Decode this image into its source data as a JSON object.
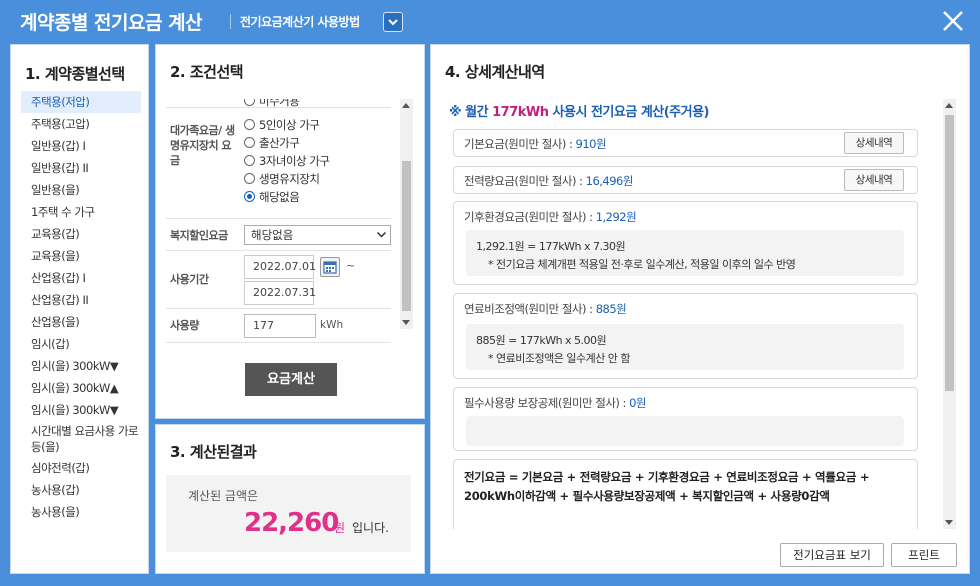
{
  "header": {
    "title": "계약종별 전기요금 계산",
    "help_link": "전기요금계산기 사용방법"
  },
  "panel1": {
    "title": "1. 계약종별선택",
    "items": [
      "주택용(저압)",
      "주택용(고압)",
      "일반용(갑) I",
      "일반용(갑) II",
      "일반용(을)",
      "1주택 수 가구",
      "교육용(갑)",
      "교육용(을)",
      "산업용(갑) I",
      "산업용(갑) II",
      "산업용(을)",
      "임시(갑)",
      "임시(을) 300kW▼",
      "임시(을) 300kW▲",
      "임시(을) 300kW▼",
      "시간대별 요금사용 가로등(을)",
      "심야전력(갑)",
      "농사용(갑)",
      "농사용(을)"
    ],
    "selected_index": 0
  },
  "panel2": {
    "title": "2. 조건선택",
    "top_partial_option": "미수거용",
    "family_label": "대가족요금/ 생명유지장치 요금",
    "family_options": [
      "5인이상 가구",
      "출산가구",
      "3자녀이상 가구",
      "생명유지장치",
      "해당없음"
    ],
    "family_selected": 4,
    "welfare_label": "복지할인요금",
    "welfare_value": "해당없음",
    "period_label": "사용기간",
    "period_start": "2022.07.01",
    "period_sep": "~",
    "period_end": "2022.07.31",
    "usage_label": "사용량",
    "usage_value": "177",
    "usage_unit": "kWh",
    "calc_button": "요금계산"
  },
  "panel3": {
    "title": "3. 계산된결과",
    "label": "계산된 금액은",
    "amount": "22,260",
    "unit": "원",
    "suffix": "입니다."
  },
  "panel4": {
    "title": "4. 상세계산내역",
    "head_prefix": "※ 월간 ",
    "head_usage": "177kWh",
    "head_suffix": " 사용시 전기요금 계산(주거용)",
    "basic_label": "기본요금(원미만 절사) : ",
    "basic_value": "910원",
    "basic_button": "상세내역",
    "energy_label": "전력량요금(원미만 절사) : ",
    "energy_value": "16,496원",
    "energy_button": "상세내역",
    "climate_label": "기후환경요금(원미만 절사) : ",
    "climate_value": "1,292원",
    "climate_calc": "1,292.1원 = 177kWh x 7.30원",
    "climate_note": "* 전기요금 체계개편 적용일 전·후로 일수계산, 적용일 이후의 일수 반영",
    "fuel_label": "연료비조정액(원미만 절사) : ",
    "fuel_value": "885원",
    "fuel_calc": "885원 = 177kWh x 5.00원",
    "fuel_note": "* 연료비조정액은 일수계산 안 함",
    "essential_label": "필수사용량 보장공제(원미만 절사) : ",
    "essential_value": "0원",
    "formula": "전기요금 = 기본요금 + 전력량요금 + 기후환경요금 + 연료비조정요금 + 역률요금 + 200kWh이하감액 + 필수사용량보장공제액 + 복지할인금액 + 사용량0감액",
    "table_button": "전기요금표 보기",
    "print_button": "프린트"
  },
  "colors": {
    "header_bg": "#4a8fdb",
    "accent_blue": "#1a5fb4",
    "amount_pink": "#e0308a",
    "calc_button_bg": "#555555"
  }
}
